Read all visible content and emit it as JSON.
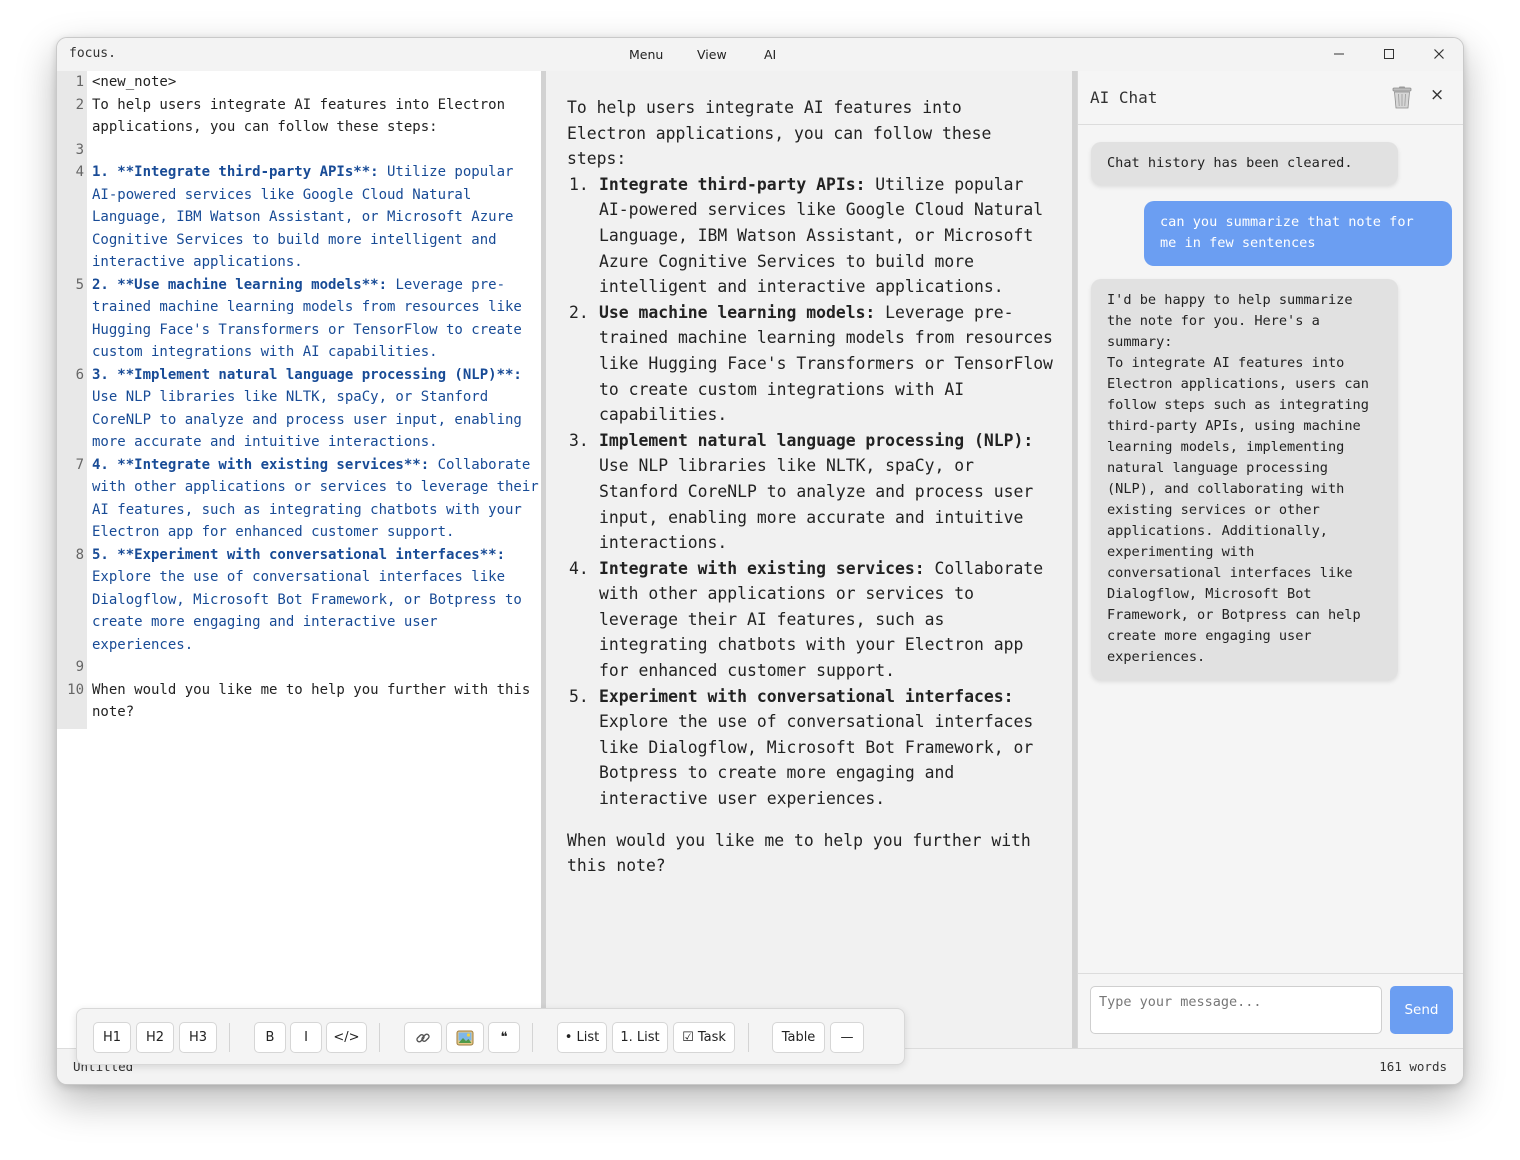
{
  "window": {
    "app_name": "focus."
  },
  "menu": {
    "items": [
      "Menu",
      "View",
      "AI"
    ]
  },
  "editor": {
    "lines": [
      {
        "n": "1",
        "segments": [
          {
            "t": "<new_note>",
            "bold": false
          }
        ],
        "blue": false
      },
      {
        "n": "2",
        "segments": [
          {
            "t": "To help users integrate AI features into Electron applications, you can follow these steps:",
            "bold": false
          }
        ],
        "blue": false
      },
      {
        "n": "3",
        "segments": [
          {
            "t": "",
            "bold": false
          }
        ],
        "blue": false
      },
      {
        "n": "4",
        "segments": [
          {
            "t": "1. **Integrate third-party APIs**:",
            "bold": true
          },
          {
            "t": " Utilize popular AI-powered services like Google Cloud Natural Language, IBM Watson Assistant, or Microsoft Azure Cognitive Services to build more intelligent and interactive applications.",
            "bold": false
          }
        ],
        "blue": true
      },
      {
        "n": "5",
        "segments": [
          {
            "t": "2. **Use machine learning models**:",
            "bold": true
          },
          {
            "t": " Leverage pre-trained machine learning models from resources like Hugging Face's Transformers or TensorFlow to create custom integrations with AI capabilities.",
            "bold": false
          }
        ],
        "blue": true
      },
      {
        "n": "6",
        "segments": [
          {
            "t": "3. **Implement natural language processing (NLP)**:",
            "bold": true
          },
          {
            "t": " Use NLP libraries like NLTK, spaCy, or Stanford CoreNLP to analyze and process user input, enabling more accurate and intuitive interactions.",
            "bold": false
          }
        ],
        "blue": true
      },
      {
        "n": "7",
        "segments": [
          {
            "t": "4. **Integrate with existing services**:",
            "bold": true
          },
          {
            "t": " Collaborate with other applications or services to leverage their AI features, such as integrating chatbots with your Electron app for enhanced customer support.",
            "bold": false
          }
        ],
        "blue": true
      },
      {
        "n": "8",
        "segments": [
          {
            "t": "5. **Experiment with conversational interfaces**:",
            "bold": true
          },
          {
            "t": " Explore the use of conversational interfaces like Dialogflow, Microsoft Bot Framework, or Botpress to create more engaging and interactive user experiences.",
            "bold": false
          }
        ],
        "blue": true
      },
      {
        "n": "9",
        "segments": [
          {
            "t": "",
            "bold": false
          }
        ],
        "blue": false
      },
      {
        "n": "10",
        "segments": [
          {
            "t": "When would you like me to help you further with this note?",
            "bold": false
          }
        ],
        "blue": false
      }
    ]
  },
  "preview": {
    "intro": "To help users integrate AI features into Electron applications, you can follow these steps:",
    "items": [
      {
        "num": "1.",
        "title": "Integrate third-party APIs:",
        "body": " Utilize popular AI-powered services like Google Cloud Natural Language, IBM Watson Assistant, or Microsoft Azure Cognitive Services to build more intelligent and interactive applications."
      },
      {
        "num": "2.",
        "title": "Use machine learning models:",
        "body": " Leverage pre-trained machine learning models from resources like Hugging Face's Transformers or TensorFlow to create custom integrations with AI capabilities."
      },
      {
        "num": "3.",
        "title": "Implement natural language processing (NLP):",
        "body": " Use NLP libraries like NLTK, spaCy, or Stanford CoreNLP to analyze and process user input, enabling more accurate and intuitive interactions."
      },
      {
        "num": "4.",
        "title": "Integrate with existing services:",
        "body": " Collaborate with other applications or services to leverage their AI features, such as integrating chatbots with your Electron app for enhanced customer support."
      },
      {
        "num": "5.",
        "title": "Experiment with conversational interfaces:",
        "body": " Explore the use of conversational interfaces like Dialogflow, Microsoft Bot Framework, or Botpress to create more engaging and interactive user experiences."
      }
    ],
    "closing": "When would you like me to help you further with this note?"
  },
  "chat": {
    "title": "AI Chat",
    "trash_icon": "trash-icon",
    "close_label": "×",
    "messages": [
      {
        "role": "ai",
        "text": "Chat history has been cleared."
      },
      {
        "role": "user",
        "text": "can you summarize that note for\nme in few sentences"
      },
      {
        "role": "ai",
        "text": "I'd be happy to help summarize\nthe note for you. Here's a\nsummary:\nTo integrate AI features into\nElectron applications, users can\nfollow steps such as integrating\nthird-party APIs, using machine\nlearning models, implementing\nnatural language processing\n(NLP), and collaborating with\nexisting services or other\napplications. Additionally,\nexperimenting with\nconversational interfaces like\nDialogflow, Microsoft Bot\nFramework, or Botpress can help\ncreate more engaging user\nexperiences."
      }
    ],
    "input_placeholder": "Type your message...",
    "send_label": "Send"
  },
  "toolbar": {
    "h1": "H1",
    "h2": "H2",
    "h3": "H3",
    "bold": "B",
    "italic": "I",
    "code": "</>",
    "link_icon": "link-icon",
    "image_icon": "image-icon",
    "quote": "❝",
    "bullet_list": "• List",
    "numbered_list": "1. List",
    "task": "☑ Task",
    "table": "Table",
    "hr": "—"
  },
  "status": {
    "filename": "Untitled",
    "word_count": "161 words"
  },
  "colors": {
    "accent": "#6b9ef2",
    "markdown_blue": "#184b96"
  }
}
